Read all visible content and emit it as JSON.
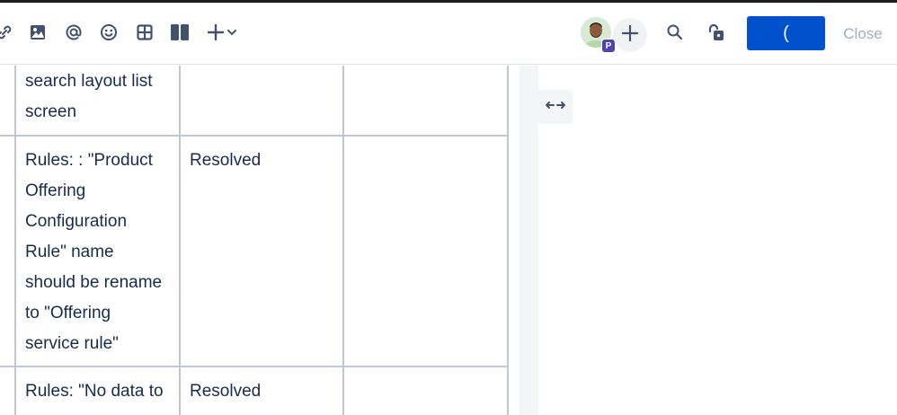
{
  "toolbar": {
    "icons": [
      "link-icon",
      "image-icon",
      "mention-icon",
      "emoji-icon",
      "table-icon",
      "layout-icon",
      "insert-more-icon",
      "search-icon",
      "restrictions-icon"
    ],
    "avatar_badge": "P",
    "publish_label": "(",
    "close_label": "Close"
  },
  "table": {
    "rows": [
      {
        "issue": "search layout list\nscreen",
        "status": "",
        "comment": ""
      },
      {
        "issue": "Rules: : \"Product\nOffering\nConfiguration\nRule\" name\nshould be rename\nto \"Offering\nservice rule\"",
        "status": "Resolved",
        "comment": ""
      },
      {
        "issue": "Rules: \"No data to",
        "status": "Resolved",
        "comment": ""
      }
    ]
  },
  "colors": {
    "primary": "#0052cc",
    "text": "#172b4d",
    "border": "#c1c7d0",
    "badge": "#5243aa"
  }
}
